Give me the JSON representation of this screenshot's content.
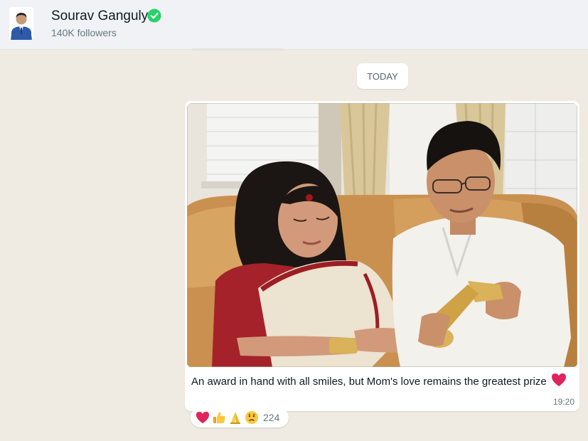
{
  "channel": {
    "name": "Sourav Ganguly",
    "followers": "140K followers",
    "verified_icon": "verified-check-icon"
  },
  "chat": {
    "date_label": "TODAY"
  },
  "message": {
    "caption": "An award in hand with all smiles, but Mom's love remains the greatest prize",
    "caption_emoji": "red-heart-icon",
    "time": "19:20",
    "photo_description": "photo-of-man-holding-award-with-mother"
  },
  "reactions": {
    "emojis": [
      "red-heart-icon",
      "thumbs-up-icon",
      "folded-hands-icon",
      "sad-face-icon"
    ],
    "count": "224"
  },
  "colors": {
    "verified_green": "#25d366",
    "chat_bg": "#efeae2",
    "header_bg": "#f0f2f5",
    "heart_red": "#e0245e"
  }
}
